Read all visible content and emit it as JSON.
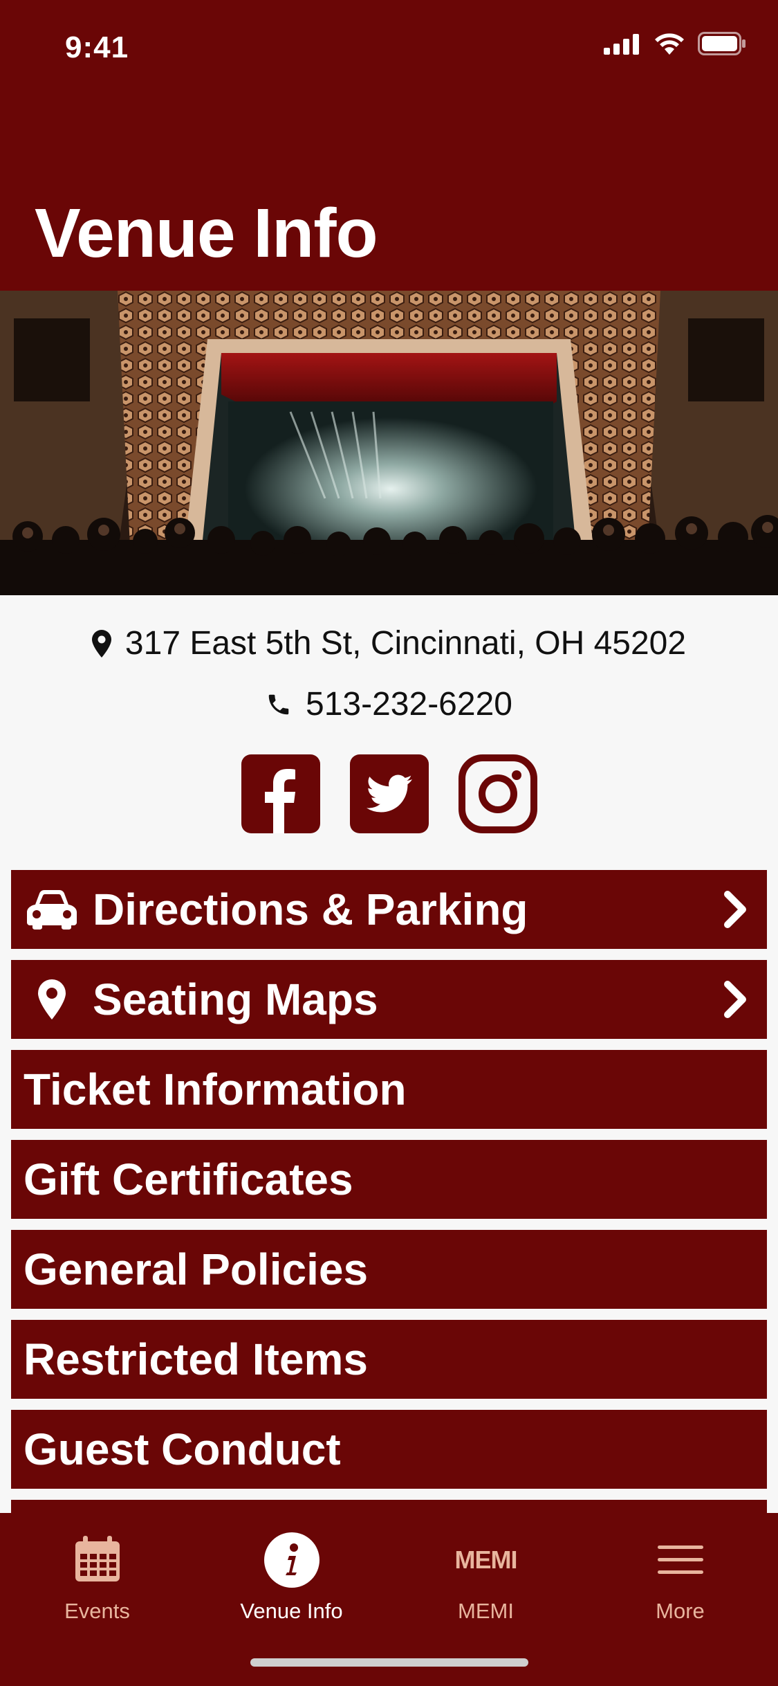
{
  "status_bar": {
    "time": "9:41"
  },
  "header": {
    "title": "Venue Info"
  },
  "venue": {
    "address": "317 East 5th St, Cincinnati, OH 45202",
    "phone": "513-232-6220",
    "social": [
      "facebook-icon",
      "twitter-icon",
      "instagram-icon"
    ]
  },
  "menu": {
    "items": [
      {
        "label": "Directions & Parking",
        "icon": "car-icon",
        "chevron": true
      },
      {
        "label": "Seating Maps",
        "icon": "map-pin-icon",
        "chevron": true
      },
      {
        "label": "Ticket Information"
      },
      {
        "label": "Gift Certificates"
      },
      {
        "label": "General Policies"
      },
      {
        "label": "Restricted Items"
      },
      {
        "label": "Guest Conduct"
      }
    ]
  },
  "tabbar": {
    "tabs": [
      {
        "label": "Events",
        "icon": "calendar-icon"
      },
      {
        "label": "Venue Info",
        "icon": "info-icon",
        "active": true
      },
      {
        "label": "MEMI",
        "icon_text": "MEMI"
      },
      {
        "label": "More",
        "icon": "hamburger-icon"
      }
    ]
  },
  "colors": {
    "brand": "#6a0606",
    "tab_inactive": "#e8b59e",
    "tab_active": "#ffffff"
  }
}
